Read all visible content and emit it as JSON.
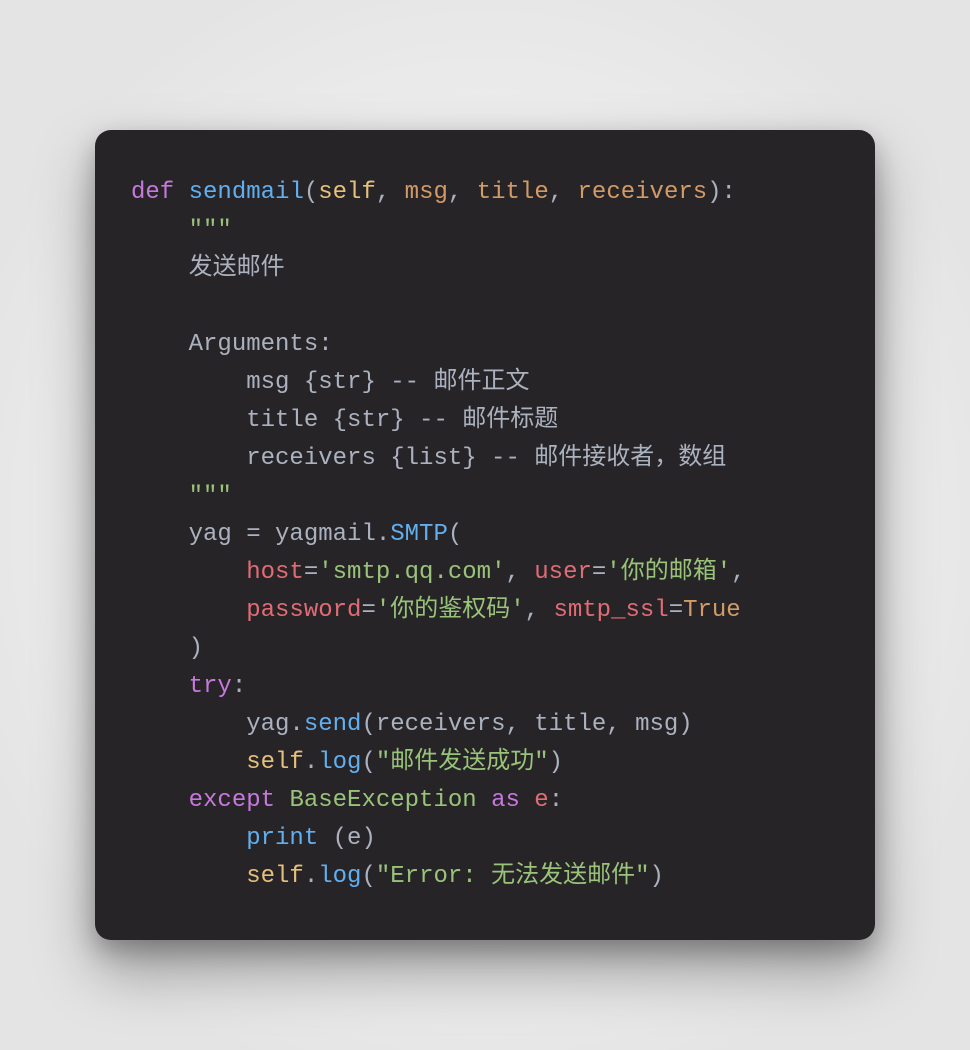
{
  "code": {
    "tokens": {
      "def": "def",
      "fn_name": "sendmail",
      "lp": "(",
      "self": "self",
      "comma": ", ",
      "p_msg": "msg",
      "p_title": "title",
      "p_receivers": "receivers",
      "rp_colon": "):",
      "tq": "\"\"\"",
      "doc_line1": "发送邮件",
      "doc_args": "Arguments:",
      "doc_msg": "msg {str} -- 邮件正文",
      "doc_title": "title {str} -- 邮件标题",
      "doc_recv": "receivers {list} -- 邮件接收者，数组",
      "yag_assign": "yag = yagmail.",
      "smtp": "SMTP",
      "open_p": "(",
      "host_key": "host",
      "eq": "=",
      "host_val": "'smtp.qq.com'",
      "user_key": "user",
      "user_val": "'你的邮箱'",
      "comma2": ",",
      "pass_key": "password",
      "pass_val": "'你的鉴权码'",
      "ssl_key": "smtp_ssl",
      "ssl_val": "True",
      "close_p": ")",
      "try": "try",
      "colon": ":",
      "yag_send_pre": "yag.",
      "send": "send",
      "send_args_open": "(",
      "send_args_close": ")",
      "self_log": "self",
      "dot": ".",
      "log": "log",
      "log_ok": "\"邮件发送成功\"",
      "except": "except",
      "baseexc": "BaseException",
      "as": "as",
      "e": "e",
      "print": "print",
      "space": " ",
      "print_arg": "(e)",
      "log_err": "\"Error: 无法发送邮件\""
    }
  }
}
